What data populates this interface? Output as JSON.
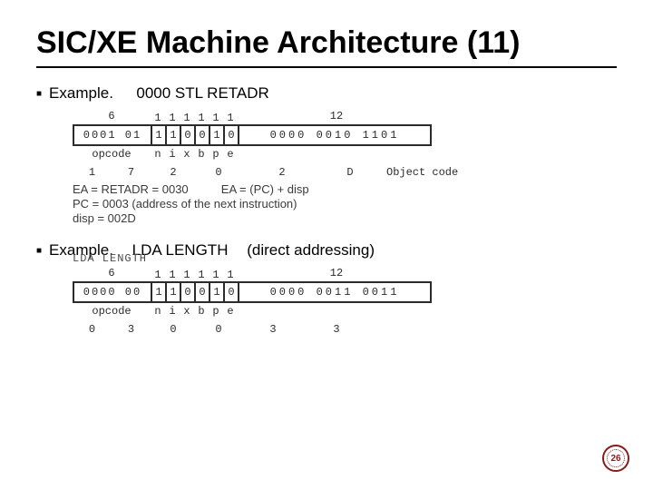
{
  "title": "SIC/XE Machine Architecture (11)",
  "ex1": {
    "label": "Example.",
    "instr": "0000 STL RETADR",
    "top_op": "6",
    "top_flags": [
      "1",
      "1",
      "1",
      "1",
      "1",
      "1"
    ],
    "top_disp": "12",
    "bits_op": "0001 01",
    "bits_flags": [
      "1",
      "1",
      "0",
      "0",
      "1",
      "0"
    ],
    "bits_disp": "0000  0010  1101",
    "lbl_op": "opcode",
    "lbl_flags": [
      "n",
      "i",
      "x",
      "b",
      "p",
      "e"
    ],
    "hex": [
      "1",
      "7",
      "2",
      "0",
      "2",
      "D"
    ],
    "hex_label": "Object code",
    "ea1": "EA = RETADR = 0030",
    "ea2": "PC = 0003 (address of the next instruction)",
    "ea3": "disp = 002D",
    "ea4": "EA = (PC) + disp"
  },
  "ex2": {
    "label": "Example.",
    "instr": "LDA LENGTH",
    "note": "(direct addressing)",
    "lda": "LDA LENGTH",
    "top_op": "6",
    "top_flags": [
      "1",
      "1",
      "1",
      "1",
      "1",
      "1"
    ],
    "top_disp": "12",
    "bits_op": "0000 00",
    "bits_flags": [
      "1",
      "1",
      "0",
      "0",
      "1",
      "0"
    ],
    "bits_disp": "0000  0011  0011",
    "lbl_op": "opcode",
    "lbl_flags": [
      "n",
      "i",
      "x",
      "b",
      "p",
      "e"
    ],
    "hex": [
      "0",
      "3",
      "0",
      "0",
      "3",
      "3"
    ]
  },
  "page": "26"
}
